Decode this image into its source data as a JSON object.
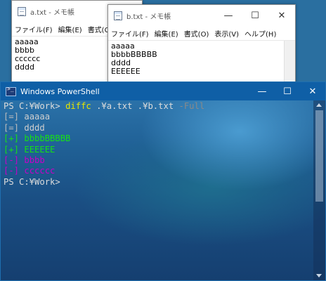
{
  "notepad_a": {
    "title": "a.txt - メモ帳",
    "menu": [
      "ファイル(F)",
      "編集(E)",
      "書式(O)"
    ],
    "lines": [
      "aaaaa",
      "bbbb",
      "cccccc",
      "dddd"
    ]
  },
  "notepad_b": {
    "title": "b.txt - メモ帳",
    "menu": [
      "ファイル(F)",
      "編集(E)",
      "書式(O)",
      "表示(V)",
      "ヘルプ(H)"
    ],
    "lines": [
      "aaaaa",
      "bbbbBBBBB",
      "dddd",
      "EEEEEE"
    ],
    "controls": [
      "—",
      "☐",
      "✕"
    ]
  },
  "powershell": {
    "title": "Windows PowerShell",
    "controls": [
      "—",
      "☐",
      "✕"
    ],
    "prompt": "PS C:¥Work>",
    "command": "diffc",
    "args": ".¥a.txt .¥b.txt",
    "param": "-Full",
    "output": [
      {
        "tag": "[=]",
        "text": "aaaaa",
        "kind": "eq"
      },
      {
        "tag": "[=]",
        "text": "dddd",
        "kind": "eq"
      },
      {
        "tag": "[+]",
        "text": "bbbbBBBBB",
        "kind": "add"
      },
      {
        "tag": "[+]",
        "text": "EEEEEE",
        "kind": "add"
      },
      {
        "tag": "[-]",
        "text": "bbbb",
        "kind": "del"
      },
      {
        "tag": "[-]",
        "text": "cccccc",
        "kind": "del"
      }
    ],
    "final_prompt": "PS C:¥Work>"
  },
  "colors": {
    "ps_titlebar": "#0f5fa6",
    "command": "#e6e600",
    "added": "#16e016",
    "removed": "#c800c8"
  }
}
